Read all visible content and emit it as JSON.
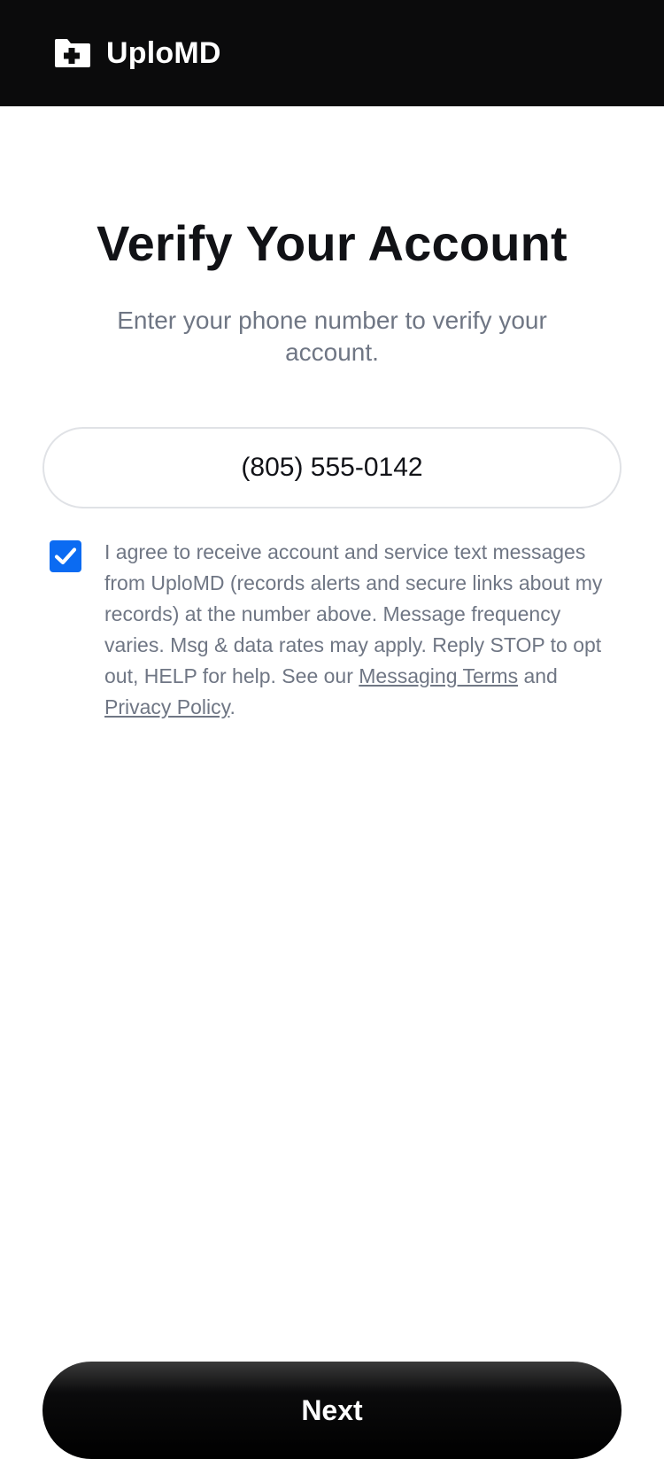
{
  "header": {
    "brand_name": "UploMD",
    "logo_icon": "folder-plus-icon",
    "background": "#0b0b0c"
  },
  "main": {
    "title": "Verify Your Account",
    "subtitle": "Enter your phone number to verify your account.",
    "phone": {
      "value": "(805) 555-0142",
      "placeholder": ""
    },
    "consent": {
      "checked": true,
      "text_before": "I agree to receive account and service text messages from UploMD (records alerts and secure links about my records) at the number above. Message frequency varies. Msg & data rates may apply. Reply STOP to opt out, HELP for help. See our ",
      "messaging_terms_link": "Messaging Terms",
      "text_and": " and ",
      "privacy_policy_link": "Privacy Policy",
      "text_end": ".",
      "checkbox_color": "#0b6bf2"
    },
    "next_button_label": "Next"
  }
}
